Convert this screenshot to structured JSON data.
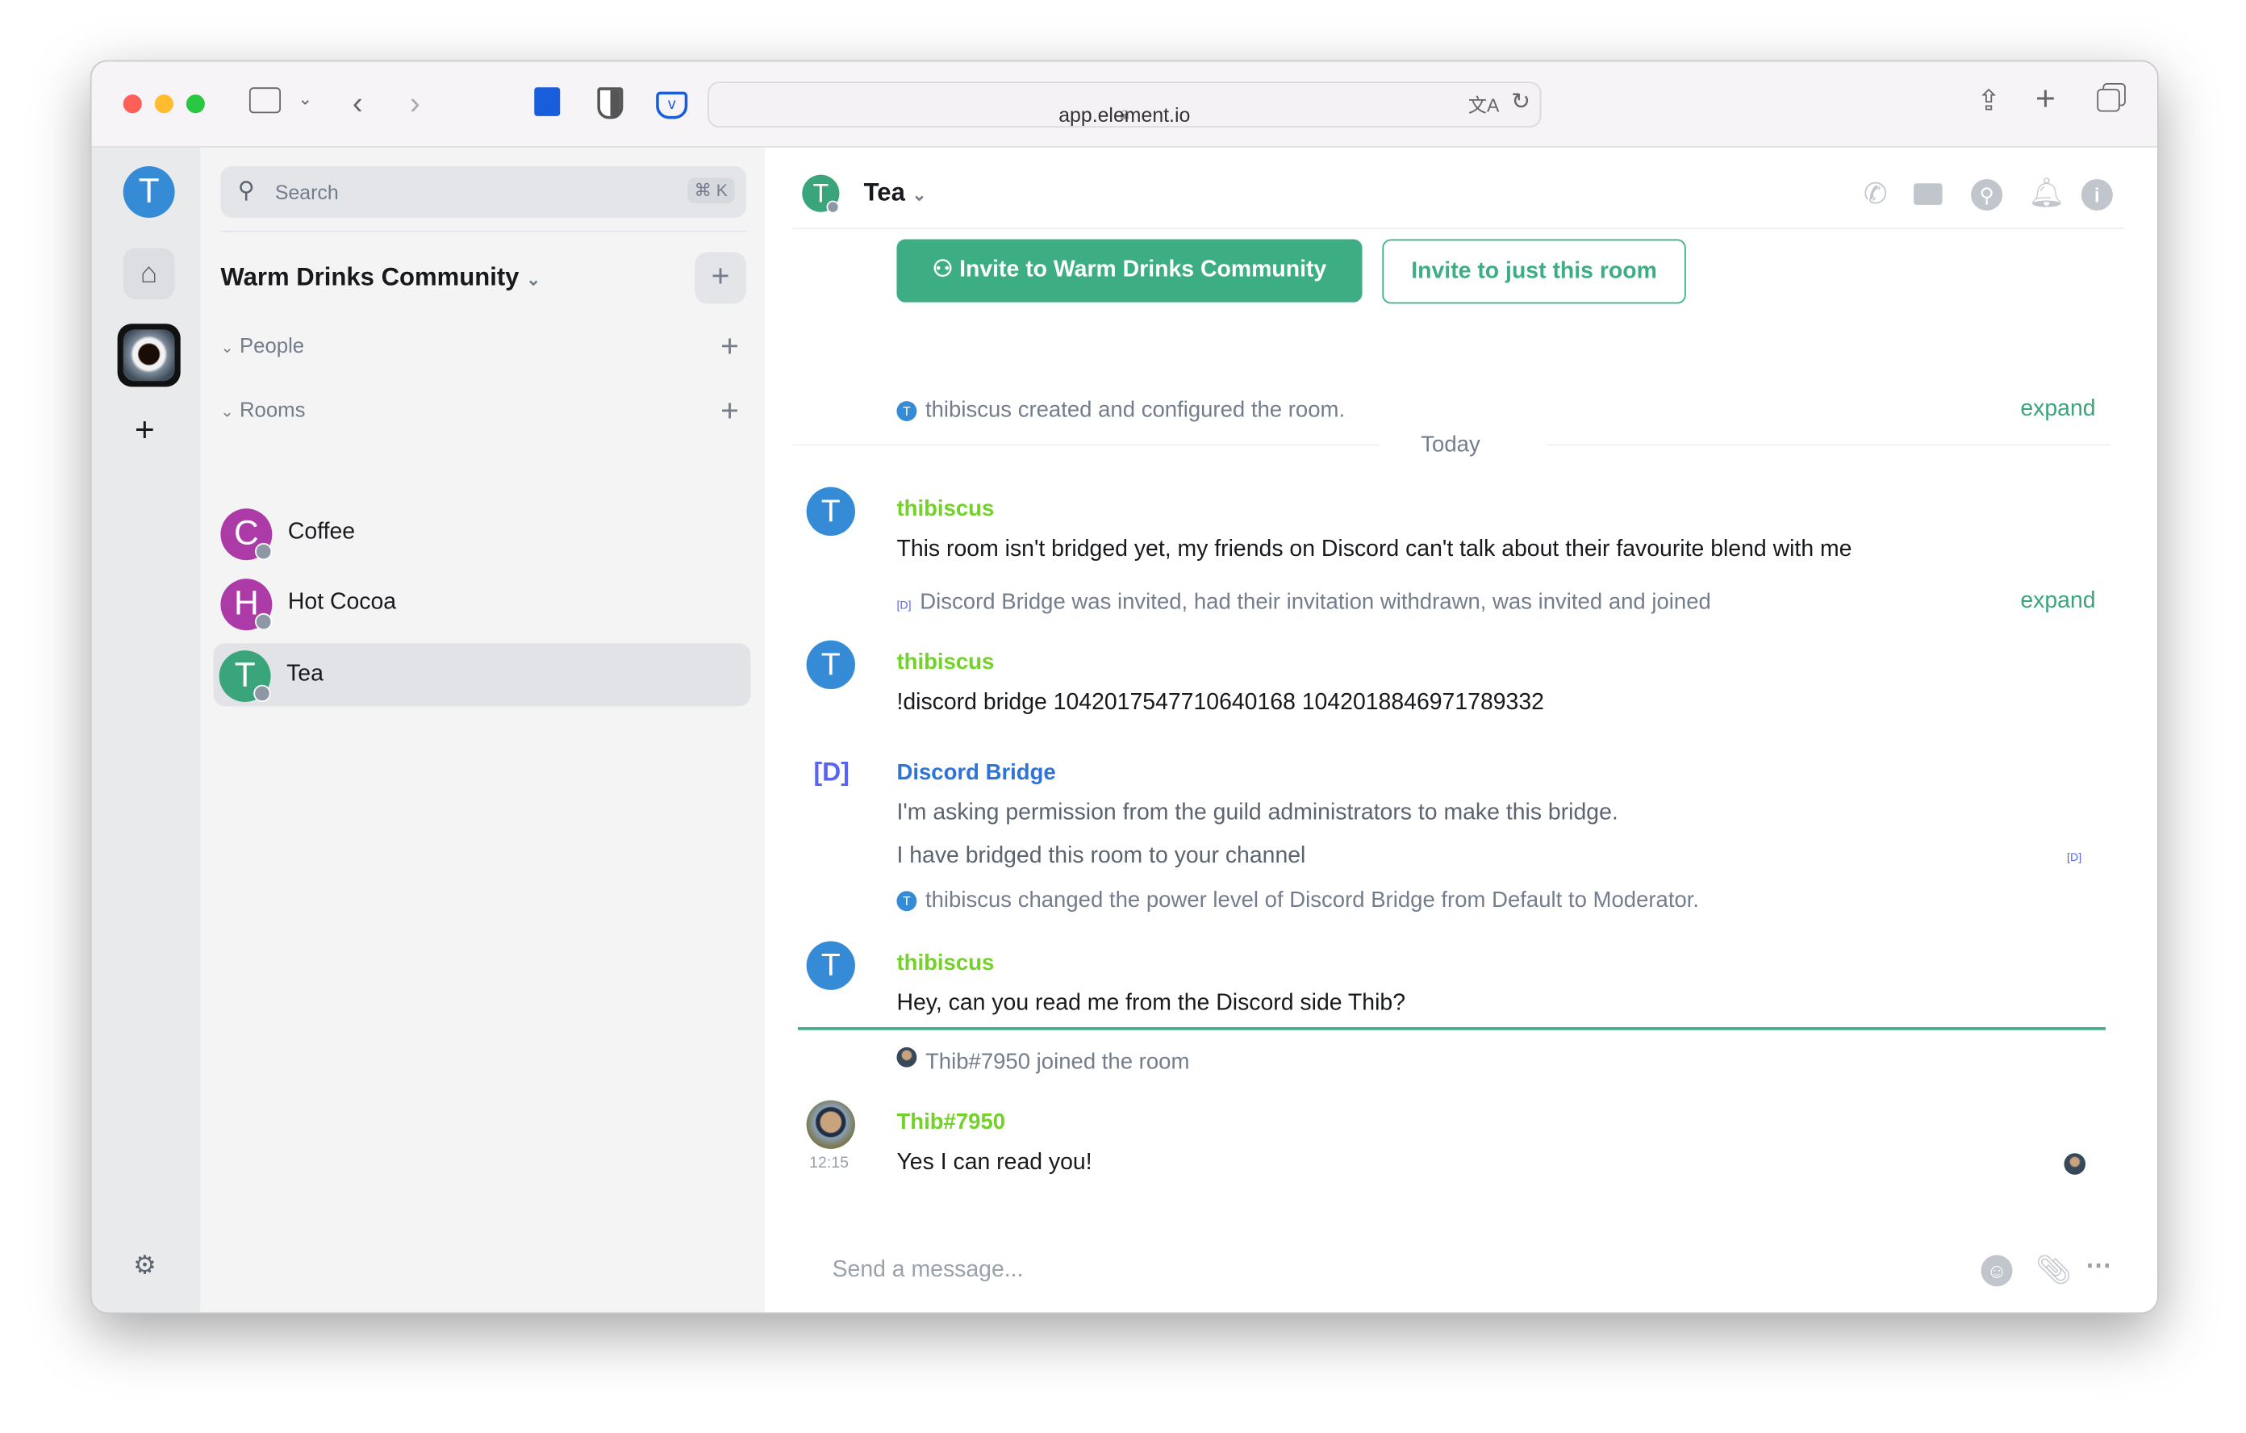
{
  "browser": {
    "url": "app.element.io",
    "icons": [
      "sidebar-icon",
      "chevron-down-icon",
      "back-icon",
      "forward-icon",
      "bitwarden-icon",
      "shield-icon",
      "pocket-icon",
      "lock-icon",
      "translate-icon",
      "reload-icon",
      "share-icon",
      "new-tab-icon",
      "tabs-overview-icon"
    ]
  },
  "rail": {
    "user_initial": "T",
    "add_label": "+"
  },
  "roomlist": {
    "search_placeholder": "Search",
    "search_shortcut": "⌘ K",
    "space_name": "Warm Drinks Community",
    "sections": [
      {
        "label": "People"
      },
      {
        "label": "Rooms"
      }
    ],
    "rooms": [
      {
        "initial": "C",
        "name": "Coffee",
        "color": "#ac3ba8"
      },
      {
        "initial": "H",
        "name": "Hot Cocoa",
        "color": "#ac3ba8"
      },
      {
        "initial": "T",
        "name": "Tea",
        "color": "#3aa57b",
        "selected": true
      }
    ]
  },
  "room": {
    "initial": "T",
    "name": "Tea",
    "invite_community": "Invite to Warm Drinks Community",
    "invite_room": "Invite to just this room",
    "created_event": "thibiscus created and configured the room.",
    "expand": "expand",
    "date_separator": "Today",
    "messages": [
      {
        "sender": "thibiscus",
        "initial": "T",
        "body": "This room isn't bridged yet, my friends on Discord can't talk about their favourite blend with me"
      },
      {
        "event": "Discord Bridge was invited, had their invitation withdrawn, was invited and joined"
      },
      {
        "sender": "thibiscus",
        "initial": "T",
        "body": "!discord bridge 1042017547710640168 1042018846971789332"
      },
      {
        "sender": "Discord Bridge",
        "avatar": "[D]",
        "body": "I'm asking permission from the guild administrators to make this bridge.",
        "body2": "I have bridged this room to your channel"
      },
      {
        "event": "thibiscus changed the power level of Discord Bridge from Default to Moderator."
      },
      {
        "sender": "thibiscus",
        "initial": "T",
        "body": "Hey, can you read me from the Discord side Thib?"
      },
      {
        "event": "Thib#7950 joined the room"
      },
      {
        "sender": "Thib#7950",
        "timestamp": "12:15",
        "body": "Yes I can read you!"
      }
    ],
    "composer_placeholder": "Send a message..."
  },
  "colors": {
    "accent": "#3dae84",
    "user_blue": "#368bd6",
    "sender_green": "#74d12c",
    "bridge_blue": "#2e73d6"
  }
}
